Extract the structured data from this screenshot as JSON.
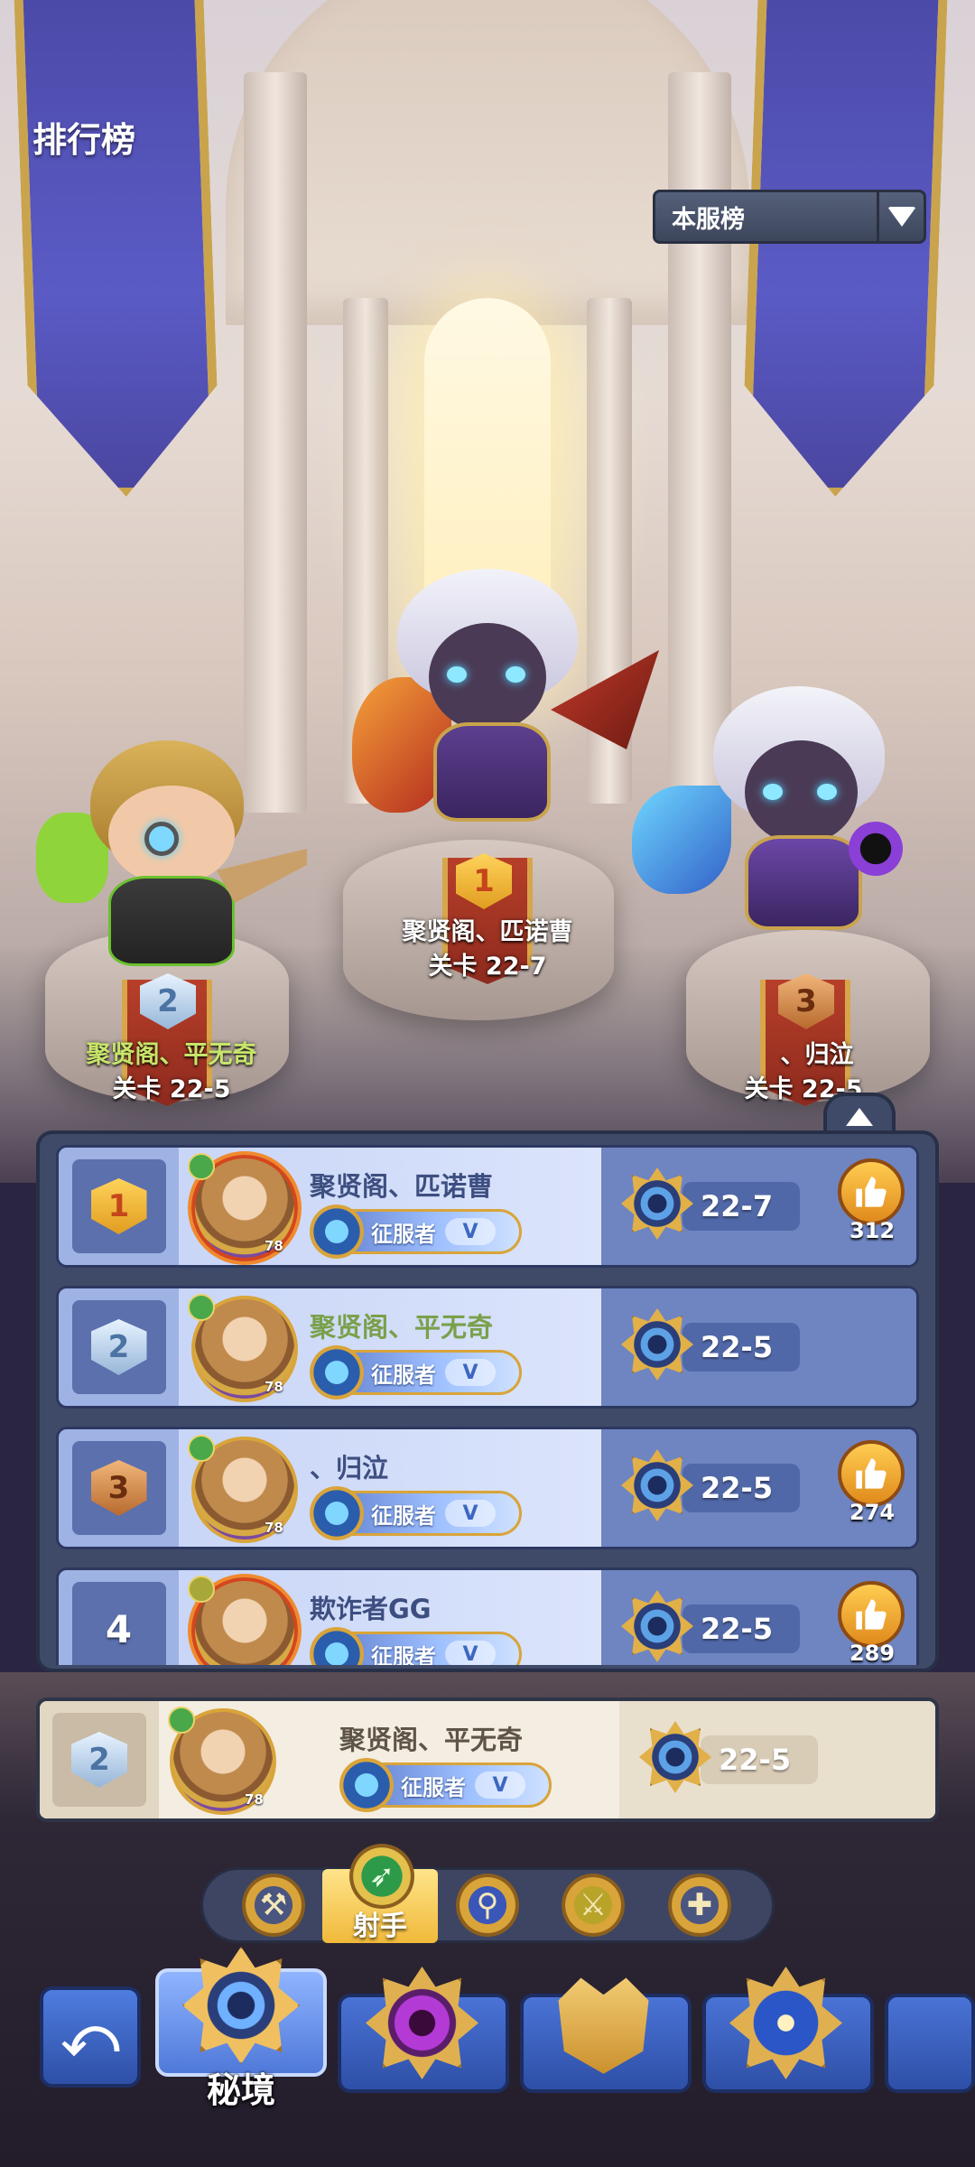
{
  "header": {
    "title": "排行榜",
    "server_filter": "本服榜"
  },
  "podium": [
    {
      "rank": "1",
      "name": "聚贤阁、匹诺曹",
      "stage": "关卡 22-7",
      "name_color": "#ffffff"
    },
    {
      "rank": "2",
      "name": "聚贤阁、平无奇",
      "stage": "关卡 22-5",
      "name_color": "#c7e56a"
    },
    {
      "rank": "3",
      "name": "、归泣",
      "stage": "关卡 22-5",
      "name_color": "#ffffff"
    }
  ],
  "leaderboard": {
    "rows": [
      {
        "rank": "1",
        "name": "聚贤阁、匹诺曹",
        "level": "78",
        "title": "征服者",
        "title_tier": "V",
        "stage": "22-7",
        "likes": "312"
      },
      {
        "rank": "2",
        "name": "聚贤阁、平无奇",
        "level": "78",
        "title": "征服者",
        "title_tier": "V",
        "stage": "22-5",
        "likes": ""
      },
      {
        "rank": "3",
        "name": "、归泣",
        "level": "78",
        "title": "征服者",
        "title_tier": "V",
        "stage": "22-5",
        "likes": "274"
      },
      {
        "rank": "4",
        "name": "欺诈者GG",
        "level": "",
        "title": "征服者",
        "title_tier": "V",
        "stage": "22-5",
        "likes": "289"
      }
    ],
    "self": {
      "rank": "2",
      "name": "聚贤阁、平无奇",
      "level": "78",
      "title": "征服者",
      "title_tier": "V",
      "stage": "22-5"
    }
  },
  "class_tabs": {
    "items": [
      "axe-class-icon",
      "archer-class-icon",
      "mage-class-icon",
      "blade-class-icon",
      "priest-class-icon"
    ],
    "selected_label": "射手"
  },
  "bottom_nav": {
    "active_label": "秘境",
    "items": [
      "back-arrow-icon",
      "secret-realm-emblem-icon",
      "purple-eye-emblem-icon",
      "crown-emblem-icon",
      "compass-emblem-icon"
    ]
  },
  "colors": {
    "row_bg": "#6f85c1",
    "self_row_bg": "#efe6d6",
    "accent_gold": "#d9a43a"
  }
}
